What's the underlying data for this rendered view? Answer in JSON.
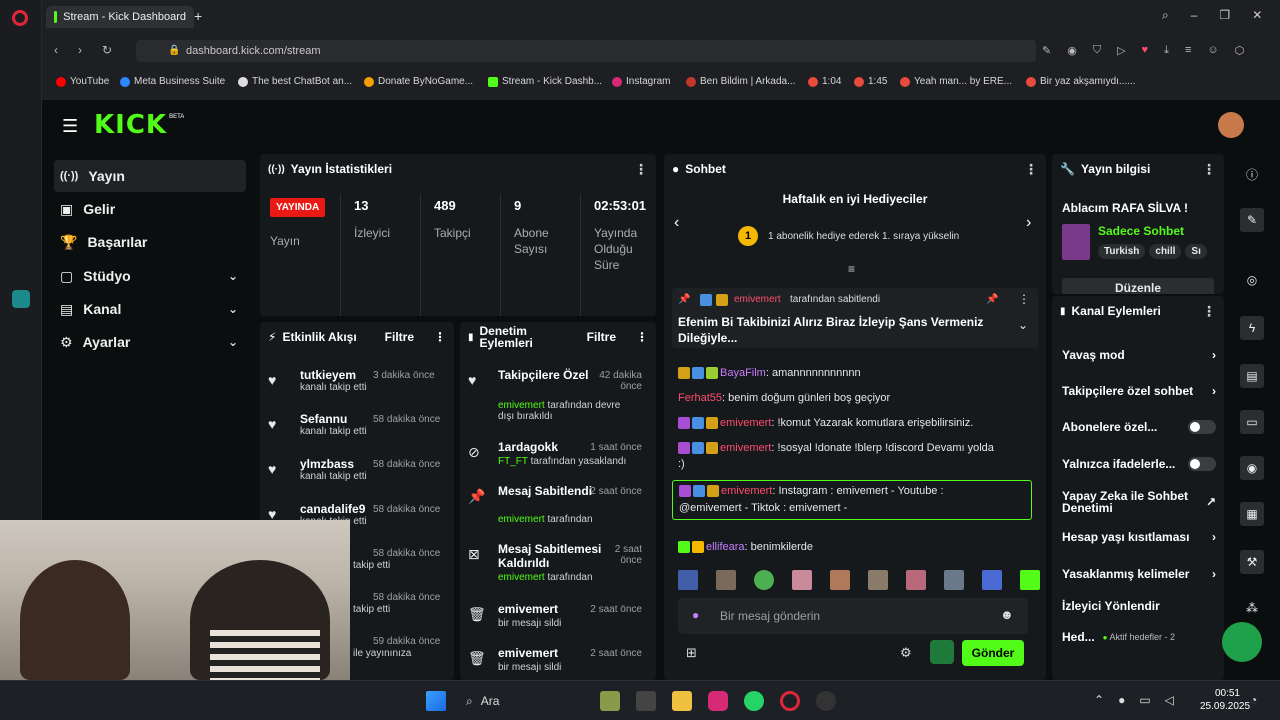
{
  "browser": {
    "tab_title": "Stream - Kick Dashboard",
    "url": "dashboard.kick.com/stream",
    "bookmarks": [
      "YouTube",
      "Meta Business Suite",
      "The best ChatBot an...",
      "Donate ByNoGame...",
      "Stream - Kick Dashb...",
      "Instagram",
      "Ben Bildim | Arkada...",
      "1:04",
      "1:45",
      "Yeah man... by ERE...",
      "Bir yaz akşamıydı......"
    ]
  },
  "app": {
    "logo": "KICK",
    "logo_sup": "BETA"
  },
  "sidebar": {
    "items": [
      {
        "label": "Yayın",
        "icon": "broadcast-icon"
      },
      {
        "label": "Gelir",
        "icon": "revenue-icon"
      },
      {
        "label": "Başarılar",
        "icon": "trophy-icon"
      },
      {
        "label": "Stüdyo",
        "icon": "studio-icon"
      },
      {
        "label": "Kanal",
        "icon": "channel-icon"
      },
      {
        "label": "Ayarlar",
        "icon": "gear-icon"
      }
    ]
  },
  "stats": {
    "title": "Yayın İstatistikleri",
    "live_badge": "YAYINDA",
    "live_label": "Yayın",
    "viewers": "13",
    "viewers_label": "İzleyici",
    "followers": "489",
    "followers_label": "Takipçi",
    "subs": "9",
    "subs_label": "Abone Sayısı",
    "duration": "02:53:01",
    "duration_label": "Yayında Olduğu Süre"
  },
  "activity": {
    "title": "Etkinlik Akışı",
    "filter": "Filtre",
    "rows": [
      {
        "name": "tutkieyem",
        "time": "3 dakika önce",
        "sub": "kanalı takip etti"
      },
      {
        "name": "Sefannu",
        "time": "58 dakika önce",
        "sub": "kanalı takip etti"
      },
      {
        "name": "ylmzbass",
        "time": "58 dakika önce",
        "sub": "kanalı takip etti"
      },
      {
        "name": "canadalife9",
        "time": "58 dakika önce",
        "sub": "kanalı takip etti"
      },
      {
        "name": "",
        "time": "58 dakika önce",
        "sub": "takip etti"
      },
      {
        "name": "",
        "time": "58 dakika önce",
        "sub": "takip etti"
      },
      {
        "name": "",
        "time": "59 dakika önce",
        "sub": "ile yayınınıza"
      }
    ]
  },
  "moderation": {
    "title": "Denetim Eylemleri",
    "filter": "Filtre",
    "rows": [
      {
        "title": "Takipçilere Özel",
        "time": "42 dakika önce",
        "user": "emivemert",
        "sub": "tarafından devre dışı bırakıldı",
        "icon": "heart-icon"
      },
      {
        "title": "1ardagokk",
        "time": "1 saat önce",
        "user": "FT_FT",
        "sub": "tarafından yasaklandı",
        "icon": "ban-icon"
      },
      {
        "title": "Mesaj Sabitlendi",
        "time": "2 saat önce",
        "user": "emivemert",
        "sub": "tarafından",
        "icon": "pin-icon"
      },
      {
        "title": "Mesaj Sabitlemesi Kaldırıldı",
        "time": "2 saat önce",
        "user": "emivemert",
        "sub": "tarafından",
        "icon": "unpin-icon"
      },
      {
        "title": "emivemert",
        "time": "2 saat önce",
        "user": "",
        "sub": "bir mesajı sildi",
        "icon": "trash-icon"
      },
      {
        "title": "emivemert",
        "time": "2 saat önce",
        "user": "",
        "sub": "bir mesajı sildi",
        "icon": "trash-icon"
      }
    ]
  },
  "chat": {
    "title": "Sohbet",
    "gifters_title": "Haftalık en iyi Hediyeciler",
    "gifters_rank": "1",
    "gifters_text": "1 abonelik hediye ederek 1. sıraya yükselin",
    "pinned_by": "tarafından sabitlendi",
    "pinned_user": "emivemert",
    "pinned_text": "Efenim Bi Takibinizi Alırız Biraz İzleyip Şans Vermeniz Dileğiyle...",
    "messages": [
      {
        "user": "BayaFilm",
        "text": ": amannnnnnnnnnn",
        "color": "#c77dff"
      },
      {
        "user": "Ferhat55",
        "text": ": benim doğum günleri boş geçiyor",
        "color": "#ff4d6d"
      },
      {
        "user": "emivemert",
        "text": ": !komut Yazarak komutlara erişebilirsiniz.",
        "color": "#ff4d6d"
      },
      {
        "user": "emivemert",
        "text": ": !sosyal !donate !blerp !discord Devamı yolda",
        "color": "#ff4d6d"
      },
      {
        "user": "",
        "text": ":)",
        "color": "#ff4d6d"
      },
      {
        "user": "emivemert",
        "text": ": Instagram : emivemert - Youtube :",
        "color": "#ff4d6d"
      },
      {
        "user": "",
        "text": "@emivemert - Tiktok : emivemert -",
        "color": "#ff4d6d"
      },
      {
        "user": "ellifeara",
        "text": ": benimkilerde",
        "color": "#c77dff"
      }
    ],
    "input_placeholder": "Bir mesaj gönderin",
    "send": "Gönder"
  },
  "info": {
    "title": "Yayın bilgisi",
    "stream_title": "Ablacım RAFA SİLVA !",
    "category": "Sadece Sohbet",
    "tags": [
      "Turkish",
      "chill",
      "Sı"
    ],
    "edit": "Düzenle"
  },
  "channel_actions": {
    "title": "Kanal Eylemleri",
    "items": [
      {
        "label": "Yavaş mod",
        "kind": "arrow"
      },
      {
        "label": "Takipçilere özel sohbet",
        "kind": "arrow"
      },
      {
        "label": "Abonelere özel...",
        "kind": "toggle"
      },
      {
        "label": "Yalnızca ifadelerle...",
        "kind": "toggle"
      },
      {
        "label": "Yapay Zeka ile Sohbet Denetimi",
        "kind": "external"
      },
      {
        "label": "Hesap yaşı kısıtlaması",
        "kind": "arrow"
      },
      {
        "label": "Yasaklanmış kelimeler",
        "kind": "arrow"
      },
      {
        "label": "İzleyici Yönlendir",
        "kind": "none"
      },
      {
        "label": "Hed...",
        "kind": "goal"
      }
    ],
    "goal_text": "Aktif hedefler - 2"
  },
  "taskbar": {
    "search": "Ara",
    "time": "00:51",
    "date": "25.09.2025"
  },
  "colors": {
    "kick_green": "#53fc18",
    "live_red": "#e91916",
    "panel": "#16191b"
  }
}
